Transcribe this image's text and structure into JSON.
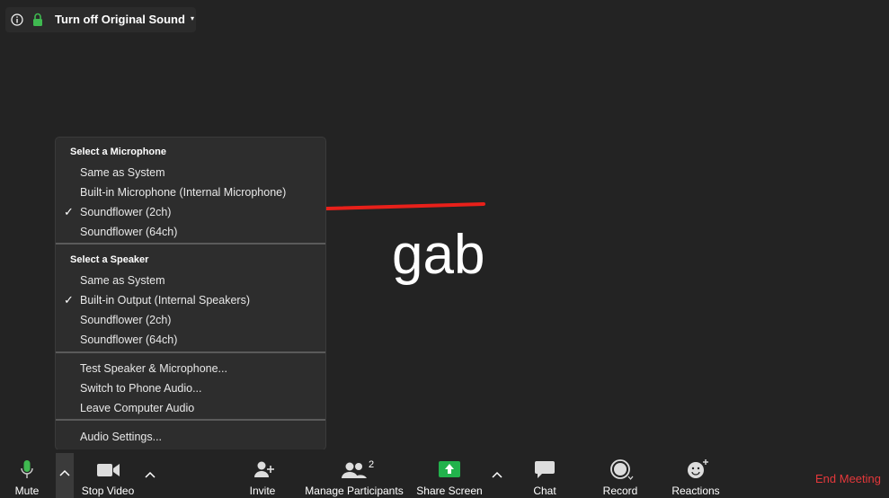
{
  "topbar": {
    "sound_label": "Turn off Original Sound",
    "caret": "▾"
  },
  "participant": {
    "name": "gab"
  },
  "menu": {
    "mic_header": "Select a Microphone",
    "mic_items": [
      {
        "label": "Same as System",
        "checked": false
      },
      {
        "label": "Built-in Microphone (Internal Microphone)",
        "checked": false
      },
      {
        "label": "Soundflower (2ch)",
        "checked": true
      },
      {
        "label": "Soundflower (64ch)",
        "checked": false
      }
    ],
    "speaker_header": "Select a Speaker",
    "speaker_items": [
      {
        "label": "Same as System",
        "checked": false
      },
      {
        "label": "Built-in Output (Internal Speakers)",
        "checked": true
      },
      {
        "label": "Soundflower (2ch)",
        "checked": false
      },
      {
        "label": "Soundflower (64ch)",
        "checked": false
      }
    ],
    "action_items": [
      "Test Speaker & Microphone...",
      "Switch to Phone Audio...",
      "Leave Computer Audio"
    ],
    "settings_item": "Audio Settings...",
    "check_glyph": "✓"
  },
  "toolbar": {
    "mute": "Mute",
    "stop_video": "Stop Video",
    "invite": "Invite",
    "manage_participants": "Manage Participants",
    "participant_count": "2",
    "share_screen": "Share Screen",
    "chat": "Chat",
    "record": "Record",
    "reactions": "Reactions",
    "end_meeting": "End Meeting"
  },
  "colors": {
    "background": "#232323",
    "menu_bg": "#2d2d2d",
    "mic_green": "#3fb950",
    "share_green": "#22b24c",
    "end_red": "#e5383b",
    "arrow_red": "#e8201a"
  }
}
